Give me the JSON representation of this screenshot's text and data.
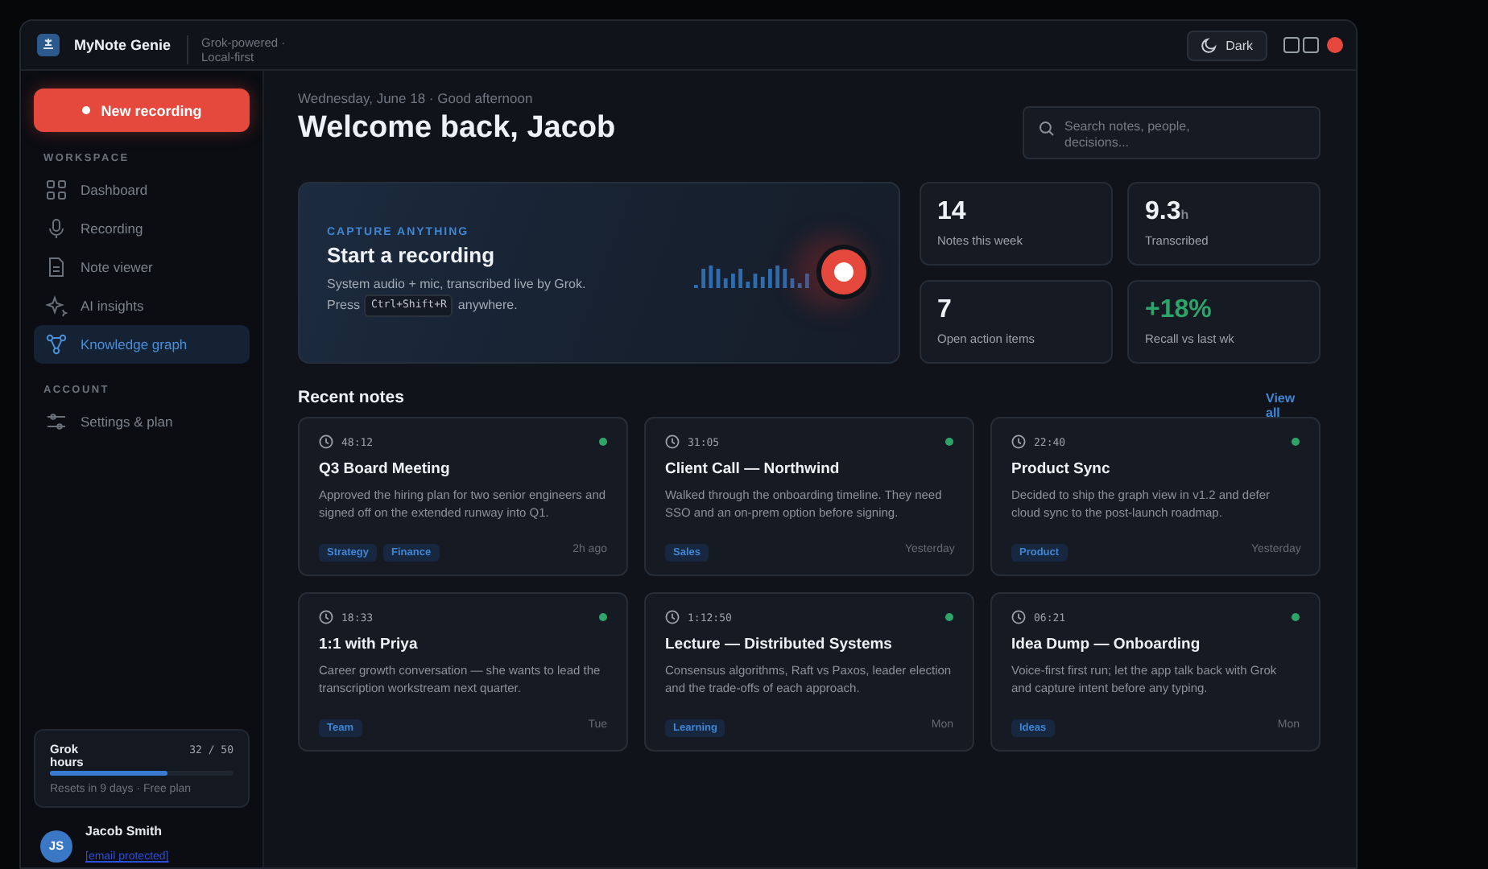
{
  "window": {
    "title": "MyNote Genie",
    "subtitle": "Grok-powered · Local-first",
    "theme_button": "Dark"
  },
  "sidebar": {
    "primary_button": "New recording",
    "sections": [
      {
        "heading": "WORKSPACE",
        "items": [
          {
            "label": "Dashboard",
            "selected": false
          },
          {
            "label": "Recording",
            "selected": false
          },
          {
            "label": "Note viewer",
            "selected": false
          },
          {
            "label": "AI insights",
            "selected": false
          },
          {
            "label": "Knowledge graph",
            "selected": true
          }
        ]
      },
      {
        "heading": "ACCOUNT",
        "items": [
          {
            "label": "Settings & plan",
            "selected": false
          }
        ]
      }
    ],
    "usage": {
      "label": "Grok hours",
      "reading": "32 / 50",
      "level": 0.64,
      "note": "Resets in 9 days · Free plan"
    },
    "user": {
      "initials": "JS",
      "name": "Jacob Smith",
      "email": "[email protected]"
    }
  },
  "header": {
    "date": "Wednesday, June 18 · Good afternoon",
    "greeting": "Welcome back, Jacob",
    "search": {
      "placeholder": "Search notes, people, decisions..."
    }
  },
  "hero": {
    "eyebrow": "CAPTURE ANYTHING",
    "title": "Start a recording",
    "line_1": "System audio + mic, transcribed live by Grok.",
    "press": "Press",
    "shortcut": "Ctrl+Shift+R",
    "after": "anywhere."
  },
  "stats": [
    {
      "value": "14",
      "label": "Notes this week",
      "kind": "plain"
    },
    {
      "value": "9.3",
      "unit": "h",
      "label": "Transcribed",
      "kind": "plain"
    },
    {
      "value": "7",
      "label": "Open action items",
      "kind": "plain"
    },
    {
      "value": "+18%",
      "label": "Recall vs last wk",
      "kind": "positive"
    }
  ],
  "recent": {
    "heading": "Recent notes",
    "link": "View all",
    "notes": [
      {
        "duration": "48:12",
        "synced": true,
        "title": "Q3 Board Meeting",
        "summary": "Approved the hiring plan for two senior engineers and signed off on the extended runway into Q1.",
        "tags": [
          "Strategy",
          "Finance"
        ],
        "when": "2h ago"
      },
      {
        "duration": "31:05",
        "synced": true,
        "title": "Client Call — Northwind",
        "summary": "Walked through the onboarding timeline. They need SSO and an on-prem option before signing.",
        "tags": [
          "Sales"
        ],
        "when": "Yesterday"
      },
      {
        "duration": "22:40",
        "synced": true,
        "title": "Product Sync",
        "summary": "Decided to ship the graph view in v1.2 and defer cloud sync to the post-launch roadmap.",
        "tags": [
          "Product"
        ],
        "when": "Yesterday"
      },
      {
        "duration": "18:33",
        "synced": true,
        "title": "1:1 with Priya",
        "summary": "Career growth conversation — she wants to lead the transcription workstream next quarter.",
        "tags": [
          "Team"
        ],
        "when": "Tue"
      },
      {
        "duration": "1:12:50",
        "synced": true,
        "title": "Lecture — Distributed Systems",
        "summary": "Consensus algorithms, Raft vs Paxos, leader election and the trade-offs of each approach.",
        "tags": [
          "Learning"
        ],
        "when": "Mon"
      },
      {
        "duration": "06:21",
        "synced": true,
        "title": "Idea Dump — Onboarding",
        "summary": "Voice-first first run; let the app talk back with Grok and capture intent before any typing.",
        "tags": [
          "Ideas"
        ],
        "when": "Mon"
      }
    ]
  }
}
